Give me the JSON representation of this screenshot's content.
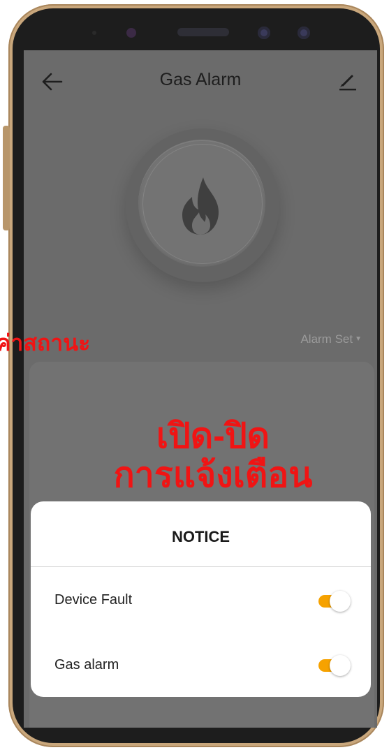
{
  "header": {
    "title": "Gas Alarm"
  },
  "device": {
    "alarm_set_label": "Alarm Set"
  },
  "annotations": {
    "status_text": "ค่าสถานะ",
    "toggle_line1": "เปิด-ปิด",
    "toggle_line2": "การแจ้งเตือน"
  },
  "notice": {
    "title": "NOTICE",
    "items": [
      {
        "label": "Device Fault",
        "enabled": true
      },
      {
        "label": "Gas alarm",
        "enabled": true
      }
    ]
  },
  "colors": {
    "toggle_on": "#f6a200",
    "annotation": "#f01414",
    "phone_frame": "#c9a77c"
  },
  "icons": {
    "back": "arrow-left-icon",
    "edit": "pencil-icon",
    "device": "flame-icon"
  }
}
